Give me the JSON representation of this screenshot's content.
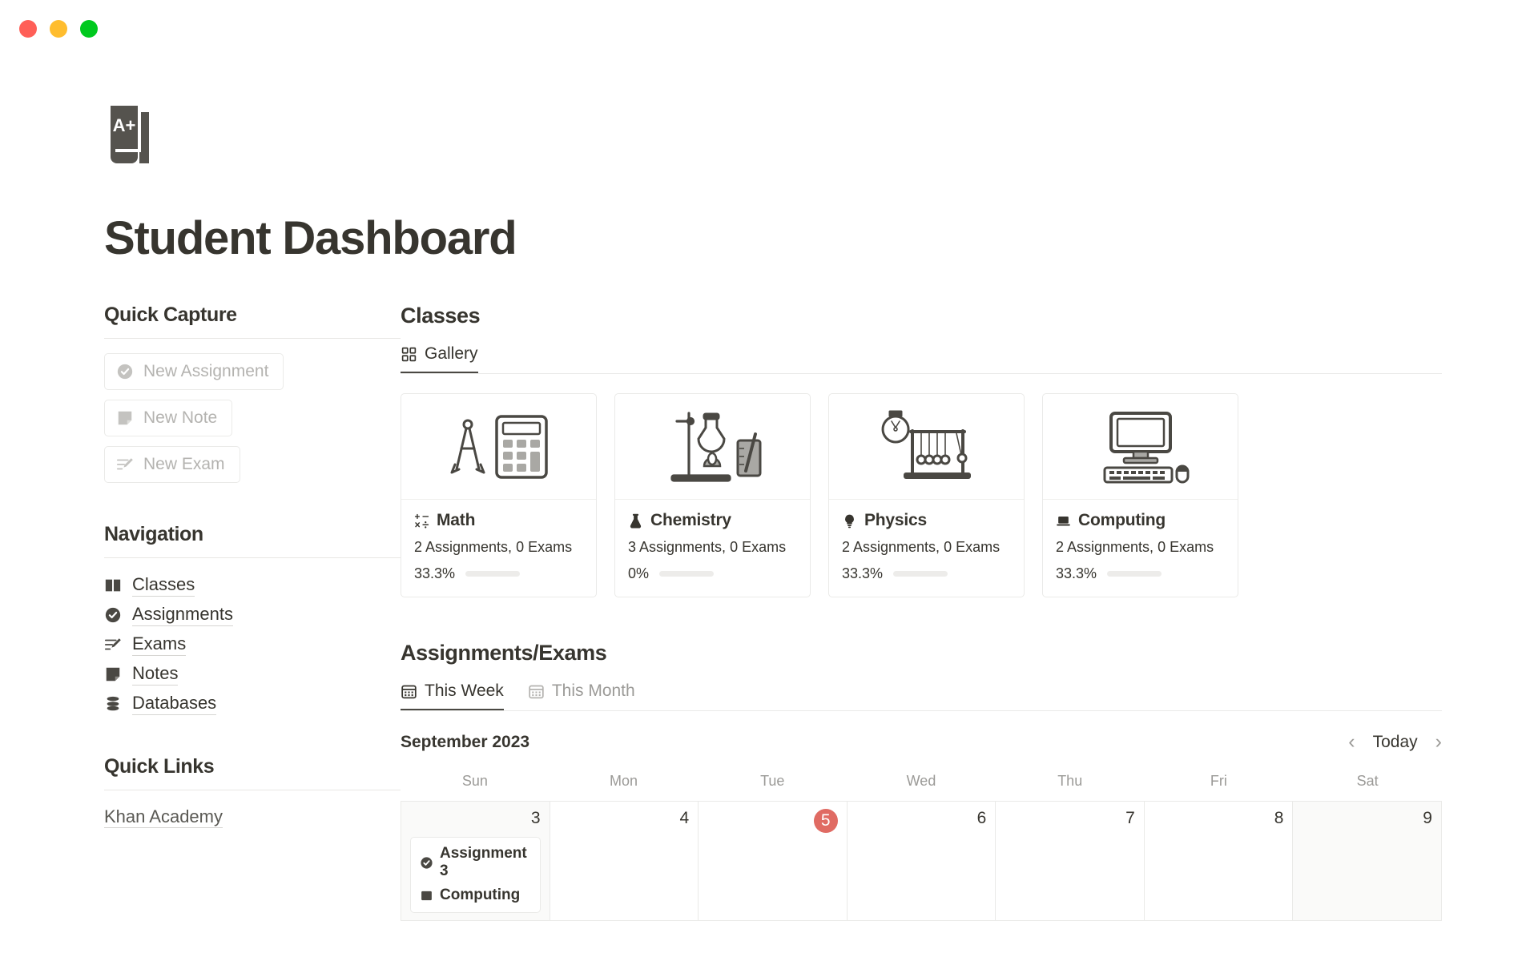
{
  "window": {
    "close_label": "close",
    "minimize_label": "minimize",
    "maximize_label": "maximize"
  },
  "header": {
    "logo_text": "A+",
    "title": "Student Dashboard"
  },
  "sidebar": {
    "quick_capture": {
      "heading": "Quick Capture",
      "buttons": [
        {
          "label": "New Assignment",
          "icon": "check-circle-icon"
        },
        {
          "label": "New Note",
          "icon": "note-icon"
        },
        {
          "label": "New Exam",
          "icon": "pencil-list-icon"
        }
      ]
    },
    "navigation": {
      "heading": "Navigation",
      "items": [
        {
          "label": "Classes",
          "icon": "book-icon"
        },
        {
          "label": "Assignments",
          "icon": "check-circle-icon"
        },
        {
          "label": "Exams",
          "icon": "pencil-list-icon"
        },
        {
          "label": "Notes",
          "icon": "note-icon"
        },
        {
          "label": "Databases",
          "icon": "database-icon"
        }
      ]
    },
    "quick_links": {
      "heading": "Quick Links",
      "links": [
        {
          "label": "Khan Academy"
        }
      ]
    }
  },
  "classes": {
    "heading": "Classes",
    "tabs": [
      {
        "label": "Gallery",
        "icon": "grid-icon",
        "active": true
      }
    ],
    "cards": [
      {
        "name": "Math",
        "icon": "math-symbols-icon",
        "illustration": "compass-calculator",
        "meta": "2 Assignments, 0 Exams",
        "percent_label": "33.3%",
        "percent_value": 33.3
      },
      {
        "name": "Chemistry",
        "icon": "flask-icon",
        "illustration": "lab-flask-burner",
        "meta": "3 Assignments, 0 Exams",
        "percent_label": "0%",
        "percent_value": 0
      },
      {
        "name": "Physics",
        "icon": "bulb-icon",
        "illustration": "bulb-newtons-cradle",
        "meta": "2 Assignments, 0 Exams",
        "percent_label": "33.3%",
        "percent_value": 33.3
      },
      {
        "name": "Computing",
        "icon": "laptop-icon",
        "illustration": "desktop-keyboard-mouse",
        "meta": "2 Assignments, 0 Exams",
        "percent_label": "33.3%",
        "percent_value": 33.3
      }
    ]
  },
  "assignments_exams": {
    "heading": "Assignments/Exams",
    "tabs": [
      {
        "label": "This Week",
        "icon": "calendar-icon",
        "active": true
      },
      {
        "label": "This Month",
        "icon": "calendar-icon",
        "active": false
      }
    ],
    "calendar": {
      "month_label": "September 2023",
      "today_label": "Today",
      "prev_label": "‹",
      "next_label": "›",
      "today_badge_color": "#E06B63",
      "weekdays": [
        "Sun",
        "Mon",
        "Tue",
        "Wed",
        "Thu",
        "Fri",
        "Sat"
      ],
      "days": [
        {
          "number": "3",
          "weekend": true,
          "today": false,
          "events": [
            {
              "title": "Assignment 3",
              "title_icon": "check-circle-icon",
              "subject": "Computing",
              "subject_icon": "laptop-square-icon"
            }
          ]
        },
        {
          "number": "4",
          "weekend": false,
          "today": false,
          "events": []
        },
        {
          "number": "5",
          "weekend": false,
          "today": true,
          "events": []
        },
        {
          "number": "6",
          "weekend": false,
          "today": false,
          "events": []
        },
        {
          "number": "7",
          "weekend": false,
          "today": false,
          "events": []
        },
        {
          "number": "8",
          "weekend": false,
          "today": false,
          "events": []
        },
        {
          "number": "9",
          "weekend": true,
          "today": false,
          "events": []
        }
      ]
    }
  }
}
